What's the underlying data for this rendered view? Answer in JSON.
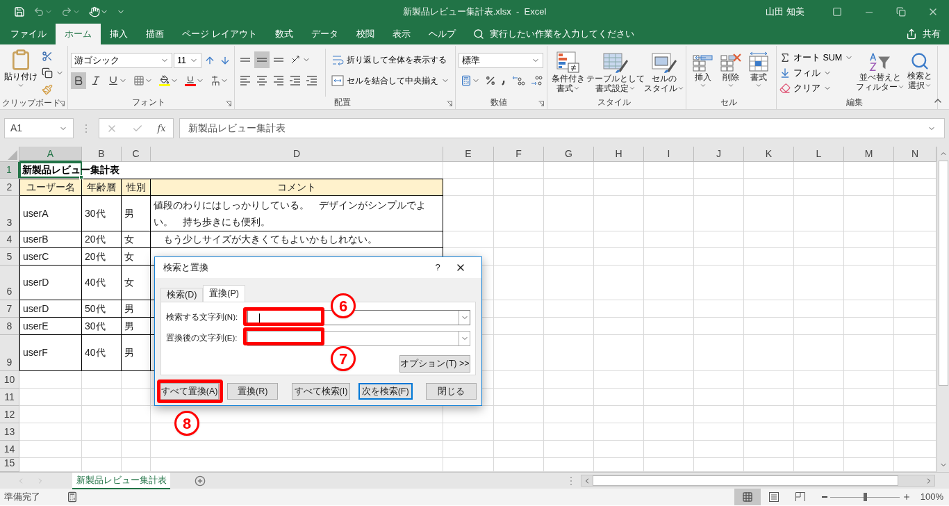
{
  "window": {
    "title": "新製品レビュー集計表.xlsx  -  Excel",
    "user": "山田 知美"
  },
  "ribbon_tabs": [
    {
      "label": "ファイル",
      "selected": false
    },
    {
      "label": "ホーム",
      "selected": true
    },
    {
      "label": "挿入",
      "selected": false
    },
    {
      "label": "描画",
      "selected": false
    },
    {
      "label": "ページ レイアウト",
      "selected": false
    },
    {
      "label": "数式",
      "selected": false
    },
    {
      "label": "データ",
      "selected": false
    },
    {
      "label": "校閲",
      "selected": false
    },
    {
      "label": "表示",
      "selected": false
    },
    {
      "label": "ヘルプ",
      "selected": false
    }
  ],
  "tell_me": "実行したい作業を入力してください",
  "share": "共有",
  "clipboard": {
    "label": "クリップボード",
    "paste": "貼り付け"
  },
  "font": {
    "label": "フォント",
    "name": "游ゴシック",
    "size": "11",
    "bold": true
  },
  "alignment": {
    "label": "配置",
    "middle": true,
    "wrap": "折り返して全体を表示する",
    "merge": "セルを結合して中央揃え"
  },
  "number": {
    "label": "数値",
    "format": "標準"
  },
  "styles": {
    "label": "スタイル",
    "buttons": [
      {
        "kind": "conditional",
        "lines": [
          "条件付き",
          "書式"
        ]
      },
      {
        "kind": "table",
        "lines": [
          "テーブルとして",
          "書式設定"
        ]
      },
      {
        "kind": "cell",
        "lines": [
          "セルの",
          "スタイル"
        ]
      }
    ]
  },
  "cells": {
    "label": "セル",
    "buttons": [
      {
        "kind": "insert",
        "label": "挿入"
      },
      {
        "kind": "delete",
        "label": "削除"
      },
      {
        "kind": "format",
        "label": "書式"
      }
    ]
  },
  "editing": {
    "label": "編集",
    "autosum": "オート SUM",
    "fill": "フィル",
    "clear": "クリア",
    "sort": [
      "並べ替えと",
      "フィルター"
    ],
    "find": [
      "検索と",
      "選択"
    ]
  },
  "formula_bar": {
    "name_box": "A1",
    "function_button": "fx",
    "formula": "新製品レビュー集計表"
  },
  "sheet": {
    "columns": [
      {
        "label": "A",
        "selected": true
      },
      {
        "label": "B",
        "selected": false
      },
      {
        "label": "C",
        "selected": false
      },
      {
        "label": "D",
        "selected": false
      },
      {
        "label": "E",
        "selected": false
      },
      {
        "label": "F",
        "selected": false
      },
      {
        "label": "G",
        "selected": false
      },
      {
        "label": "H",
        "selected": false
      },
      {
        "label": "I",
        "selected": false
      },
      {
        "label": "J",
        "selected": false
      },
      {
        "label": "K",
        "selected": false
      },
      {
        "label": "L",
        "selected": false
      },
      {
        "label": "M",
        "selected": false
      },
      {
        "label": "N",
        "selected": false
      }
    ],
    "rows": [
      {
        "label": "1",
        "selected": true,
        "cells": [
          {
            "kind": "title",
            "text": "新製品レビュー集計表",
            "selected": true
          }
        ]
      },
      {
        "label": "2",
        "selected": false,
        "cells": [
          {
            "kind": "header",
            "text": "ユーザー名"
          },
          {
            "kind": "header",
            "text": "年齢層"
          },
          {
            "kind": "header",
            "text": "性別"
          },
          {
            "kind": "header",
            "text": "コメント"
          }
        ]
      },
      {
        "label": "3",
        "selected": false,
        "cells": [
          {
            "kind": "text",
            "text": "userA"
          },
          {
            "kind": "text",
            "text": "30代"
          },
          {
            "kind": "text",
            "text": "男"
          },
          {
            "kind": "text",
            "text": "値段のわりにはしっかりしている。　デザインがシンプルでよい。　持ち歩きにも便利。"
          }
        ]
      },
      {
        "label": "4",
        "selected": false,
        "cells": [
          {
            "kind": "text",
            "text": "userB"
          },
          {
            "kind": "text",
            "text": "20代"
          },
          {
            "kind": "text",
            "text": "女"
          },
          {
            "kind": "text",
            "text": "　もう少しサイズが大きくてもよいかもしれない。"
          }
        ]
      },
      {
        "label": "5",
        "selected": false,
        "cells": [
          {
            "kind": "text",
            "text": "userC"
          },
          {
            "kind": "text",
            "text": "20代"
          },
          {
            "kind": "text",
            "text": "女"
          }
        ]
      },
      {
        "label": "6",
        "selected": false,
        "cells": [
          {
            "kind": "text",
            "text": "userD"
          },
          {
            "kind": "text",
            "text": "40代"
          },
          {
            "kind": "text",
            "text": "女"
          }
        ]
      },
      {
        "label": "7",
        "selected": false,
        "cells": [
          {
            "kind": "text",
            "text": "userD"
          },
          {
            "kind": "text",
            "text": "50代"
          },
          {
            "kind": "text",
            "text": "男"
          }
        ]
      },
      {
        "label": "8",
        "selected": false,
        "cells": [
          {
            "kind": "text",
            "text": "userE"
          },
          {
            "kind": "text",
            "text": "30代"
          },
          {
            "kind": "text",
            "text": "男"
          }
        ]
      },
      {
        "label": "9",
        "selected": false,
        "cells": [
          {
            "kind": "text",
            "text": "userF"
          },
          {
            "kind": "text",
            "text": "40代"
          },
          {
            "kind": "text",
            "text": "男"
          }
        ]
      },
      {
        "label": "10",
        "selected": false,
        "cells": []
      },
      {
        "label": "11",
        "selected": false,
        "cells": []
      },
      {
        "label": "12",
        "selected": false,
        "cells": []
      },
      {
        "label": "13",
        "selected": false,
        "cells": []
      },
      {
        "label": "14",
        "selected": false,
        "cells": []
      },
      {
        "label": "15",
        "selected": false,
        "cells": []
      }
    ]
  },
  "sheet_tabs": [
    {
      "label": "新製品レビュー集計表",
      "selected": true
    }
  ],
  "status_bar": {
    "status": "準備完了",
    "views": [
      {
        "kind": "normal",
        "selected": true
      },
      {
        "kind": "page_layout",
        "selected": false
      },
      {
        "kind": "page_break",
        "selected": false
      }
    ],
    "zoom": {
      "level": 0.5,
      "reading": "100%"
    }
  },
  "dialog": {
    "title": "検索と置換",
    "help": "?",
    "tabs": [
      {
        "label": "検索(D)",
        "selected": false
      },
      {
        "label": "置換(P)",
        "selected": true
      }
    ],
    "find": {
      "label": "検索する文字列(N):",
      "focused": true
    },
    "replace": {
      "label": "置換後の文字列(E):",
      "focused": false
    },
    "options": "オプション(T) >>",
    "buttons": [
      {
        "label": "すべて置換(A)",
        "default": false
      },
      {
        "label": "置換(R)",
        "default": false
      },
      {
        "label": "すべて検索(I)",
        "default": false
      },
      {
        "label": "次を検索(F)",
        "default": true
      },
      {
        "label": "閉じる",
        "default": false
      }
    ],
    "annotations": [
      {
        "number": "6"
      },
      {
        "number": "7"
      },
      {
        "number": "8"
      }
    ]
  }
}
